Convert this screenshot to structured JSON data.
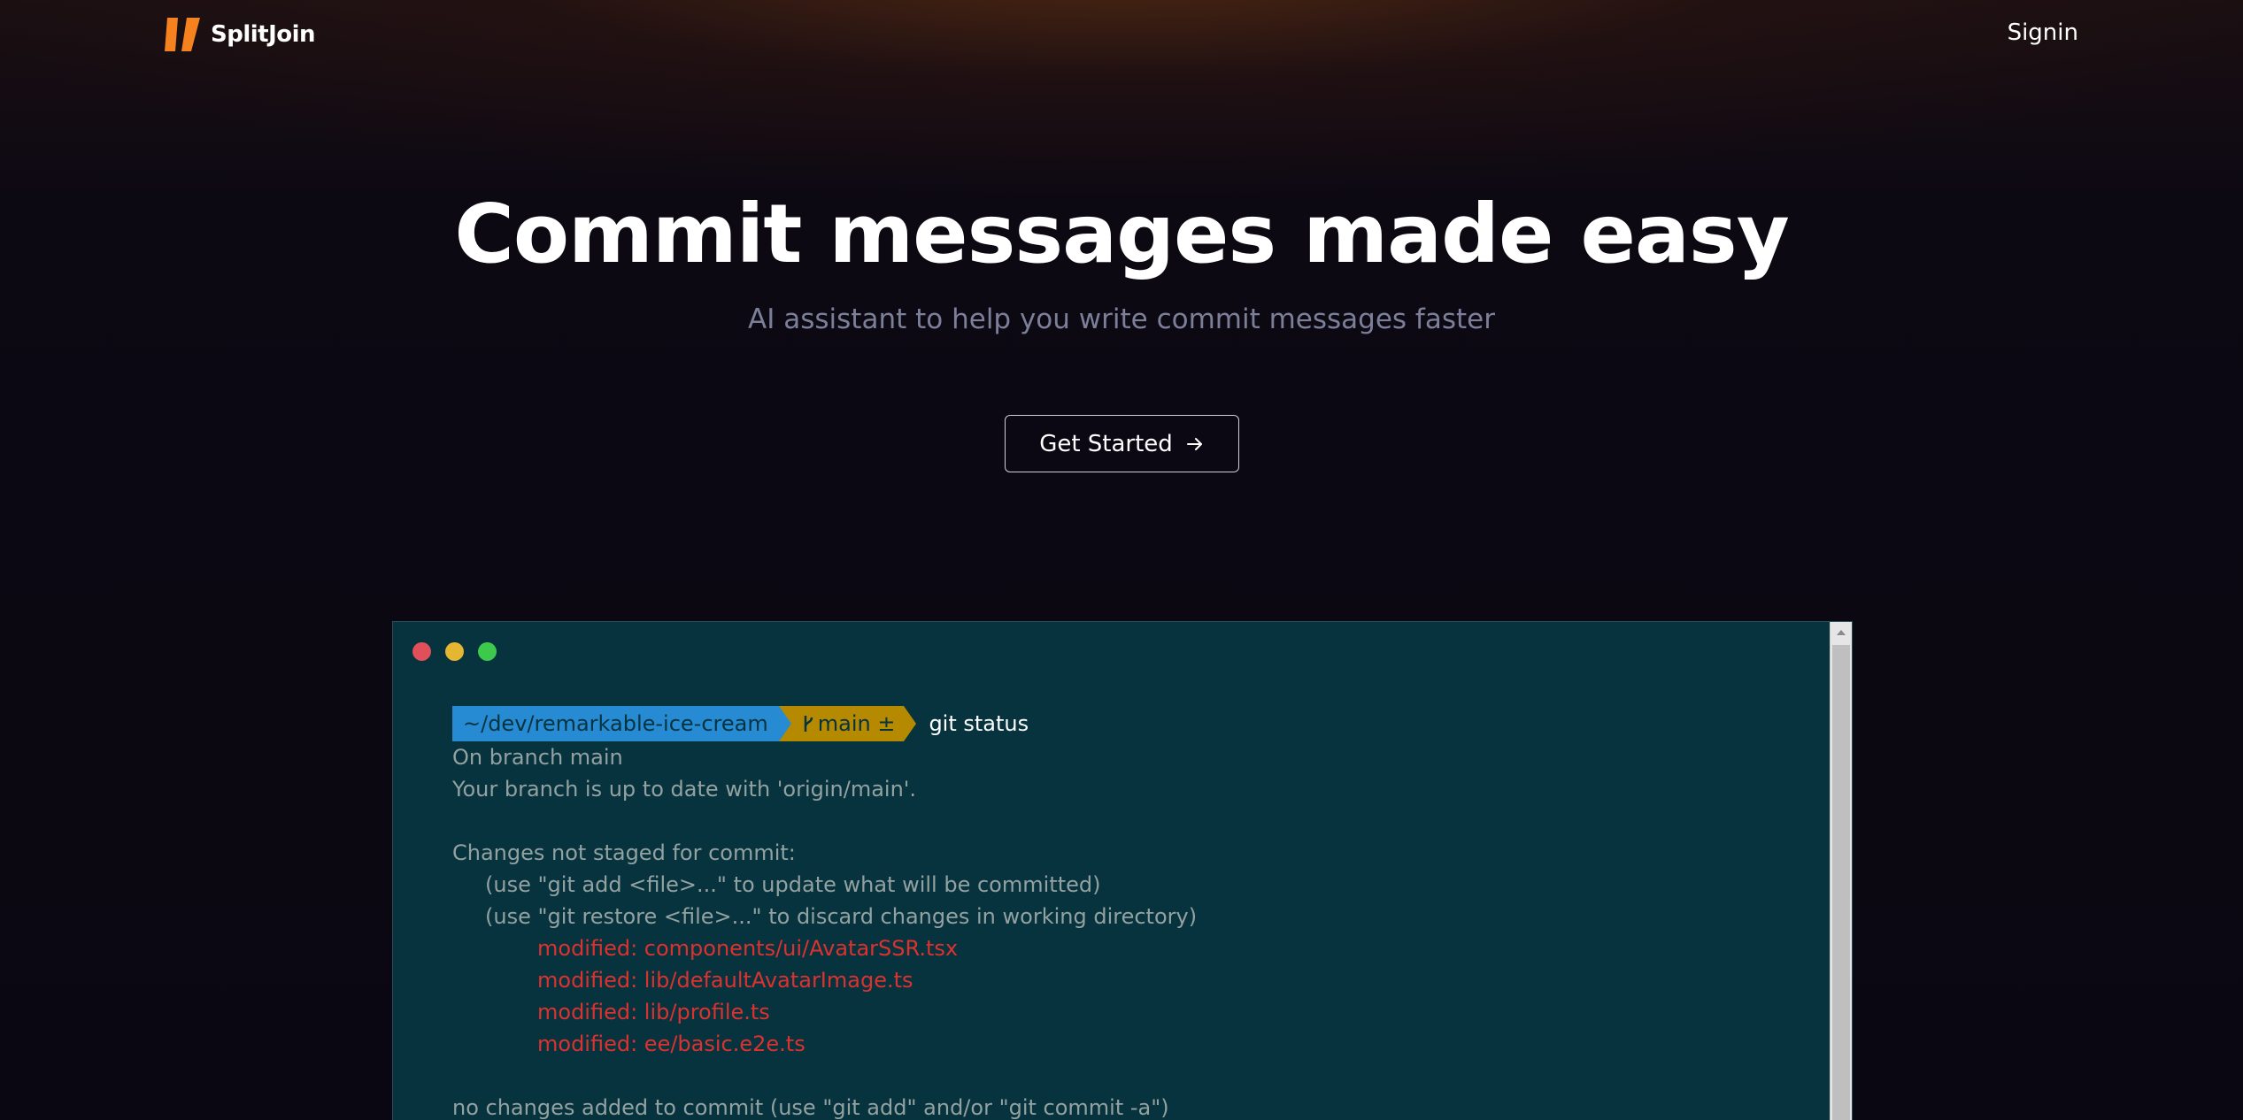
{
  "nav": {
    "brand": "SplitJoin",
    "signin": "Signin"
  },
  "hero": {
    "title": "Commit messages made easy",
    "subtitle": "AI assistant to help you write commit messages faster",
    "cta_label": "Get Started"
  },
  "terminal": {
    "prompt": {
      "path": "~/dev/remarkable-ice-cream",
      "branch": "main ±",
      "command": "git status"
    },
    "lines": [
      "On branch main",
      "Your branch is up to date with 'origin/main'.",
      "",
      "Changes not staged for commit:",
      "(use \"git add <file>...\" to update what will be committed)",
      "(use \"git restore <file>...\" to discard changes in working directory)",
      "modified: components/ui/AvatarSSR.tsx",
      "modified: lib/defaultAvatarImage.ts",
      "modified: lib/profile.ts",
      "modified: ee/basic.e2e.ts",
      "",
      "no changes added to commit (use \"git add\" and/or \"git commit -a\")"
    ]
  },
  "colors": {
    "brand_orange": "#f5821f",
    "terminal_bg": "#07333f",
    "path_segment": "#268bd2",
    "branch_segment": "#b58900",
    "modified_text": "#dc322f"
  },
  "icons": [
    "splitjoin-logo-icon",
    "arrow-right-icon",
    "git-branch-icon",
    "scroll-up-arrow-icon"
  ]
}
